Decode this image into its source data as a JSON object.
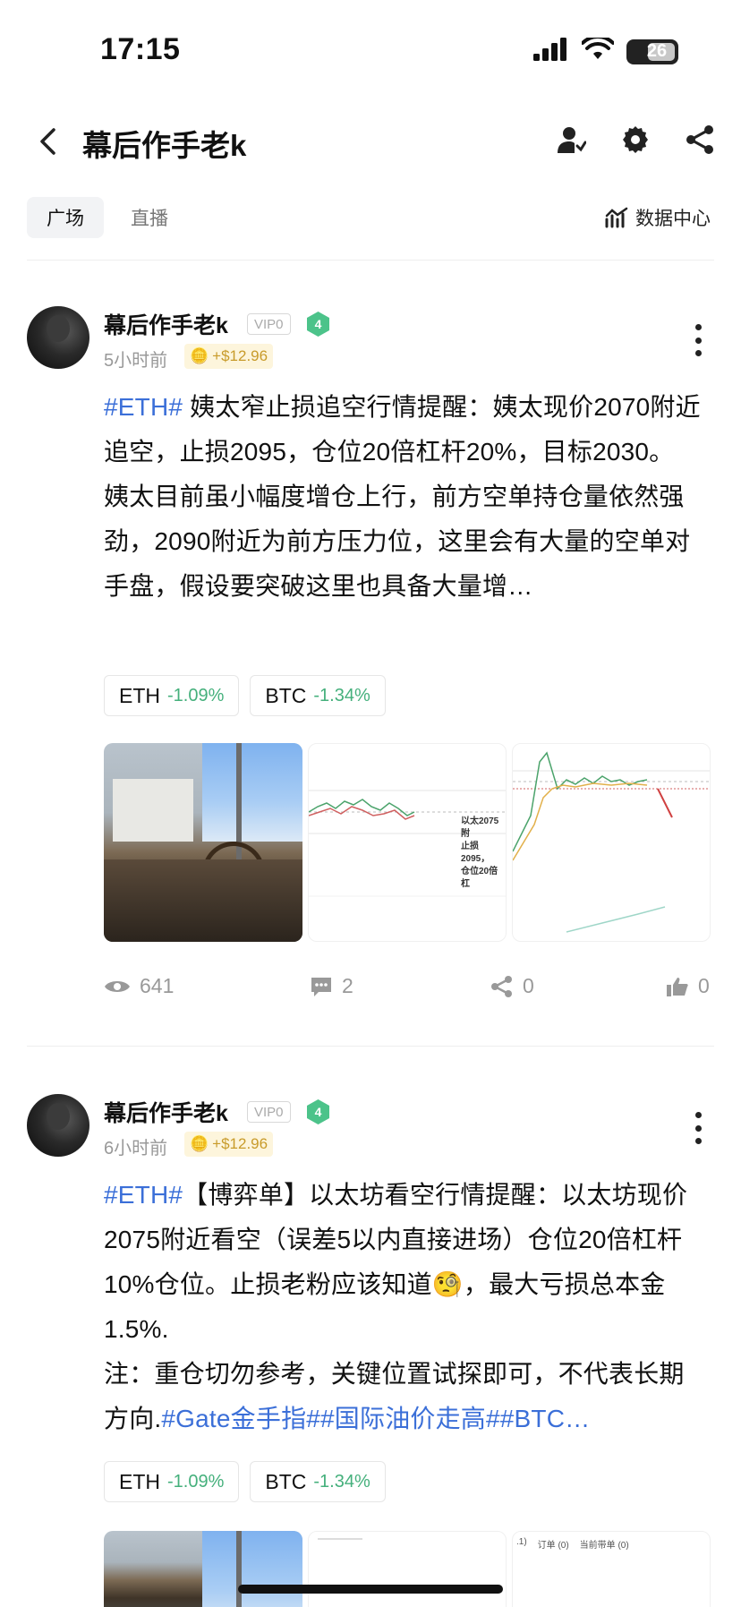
{
  "status_bar": {
    "time": "17:15",
    "battery": "26"
  },
  "header": {
    "title": "幕后作手老k"
  },
  "tabs": [
    {
      "label": "广场"
    },
    {
      "label": "直播"
    }
  ],
  "data_center": {
    "label": "数据中心"
  },
  "colors": {
    "hashtag": "#3b6fd8",
    "change_green": "#45b07c",
    "level_badge": "#4cc38a",
    "reward_gold": "#c89b2a"
  },
  "posts": [
    {
      "author": "幕后作手老k",
      "vip": "VIP0",
      "level": "4",
      "time_ago": "5小时前",
      "reward": "+$12.96",
      "hashtag": "#ETH#",
      "line1": " 姨太窄止损追空行情提醒：姨太现价2070附近追空，止损2095，仓位20倍杠杆20%，目标2030。",
      "line2": "姨太目前虽小幅度增仓上行，前方空单持仓量依然强劲，2090附近为前方压力位，这里会有大量的空单对手盘，假设要突破这里也具备大量增…",
      "tickers": [
        {
          "symbol": "ETH",
          "change": "-1.09%"
        },
        {
          "symbol": "BTC",
          "change": "-1.34%"
        }
      ],
      "chart_caption": [
        "以太2075附",
        "止损2095，",
        "仓位20倍杠"
      ],
      "views": "641",
      "comments": "2",
      "shares": "0",
      "likes": "0"
    },
    {
      "author": "幕后作手老k",
      "vip": "VIP0",
      "level": "4",
      "time_ago": "6小时前",
      "reward": "+$12.96",
      "hashtag": "#ETH#",
      "line1": "【博弈单】以太坊看空行情提醒：以太坊现价2075附近看空（误差5以内直接进场）仓位20倍杠杆10%仓位。止损老粉应该知道🧐，最大亏损总本金1.5%.",
      "line2_text": "注：重仓切勿参考，关键位置试探即可，不代表长期方向.",
      "line2_tags": "#Gate金手指##国际油价走高##BTC…",
      "tickers": [
        {
          "symbol": "ETH",
          "change": "-1.09%"
        },
        {
          "symbol": "BTC",
          "change": "-1.34%"
        }
      ],
      "partial_labels": [
        ".1)",
        "订单 (0)",
        "当前带单 (0)"
      ]
    }
  ]
}
